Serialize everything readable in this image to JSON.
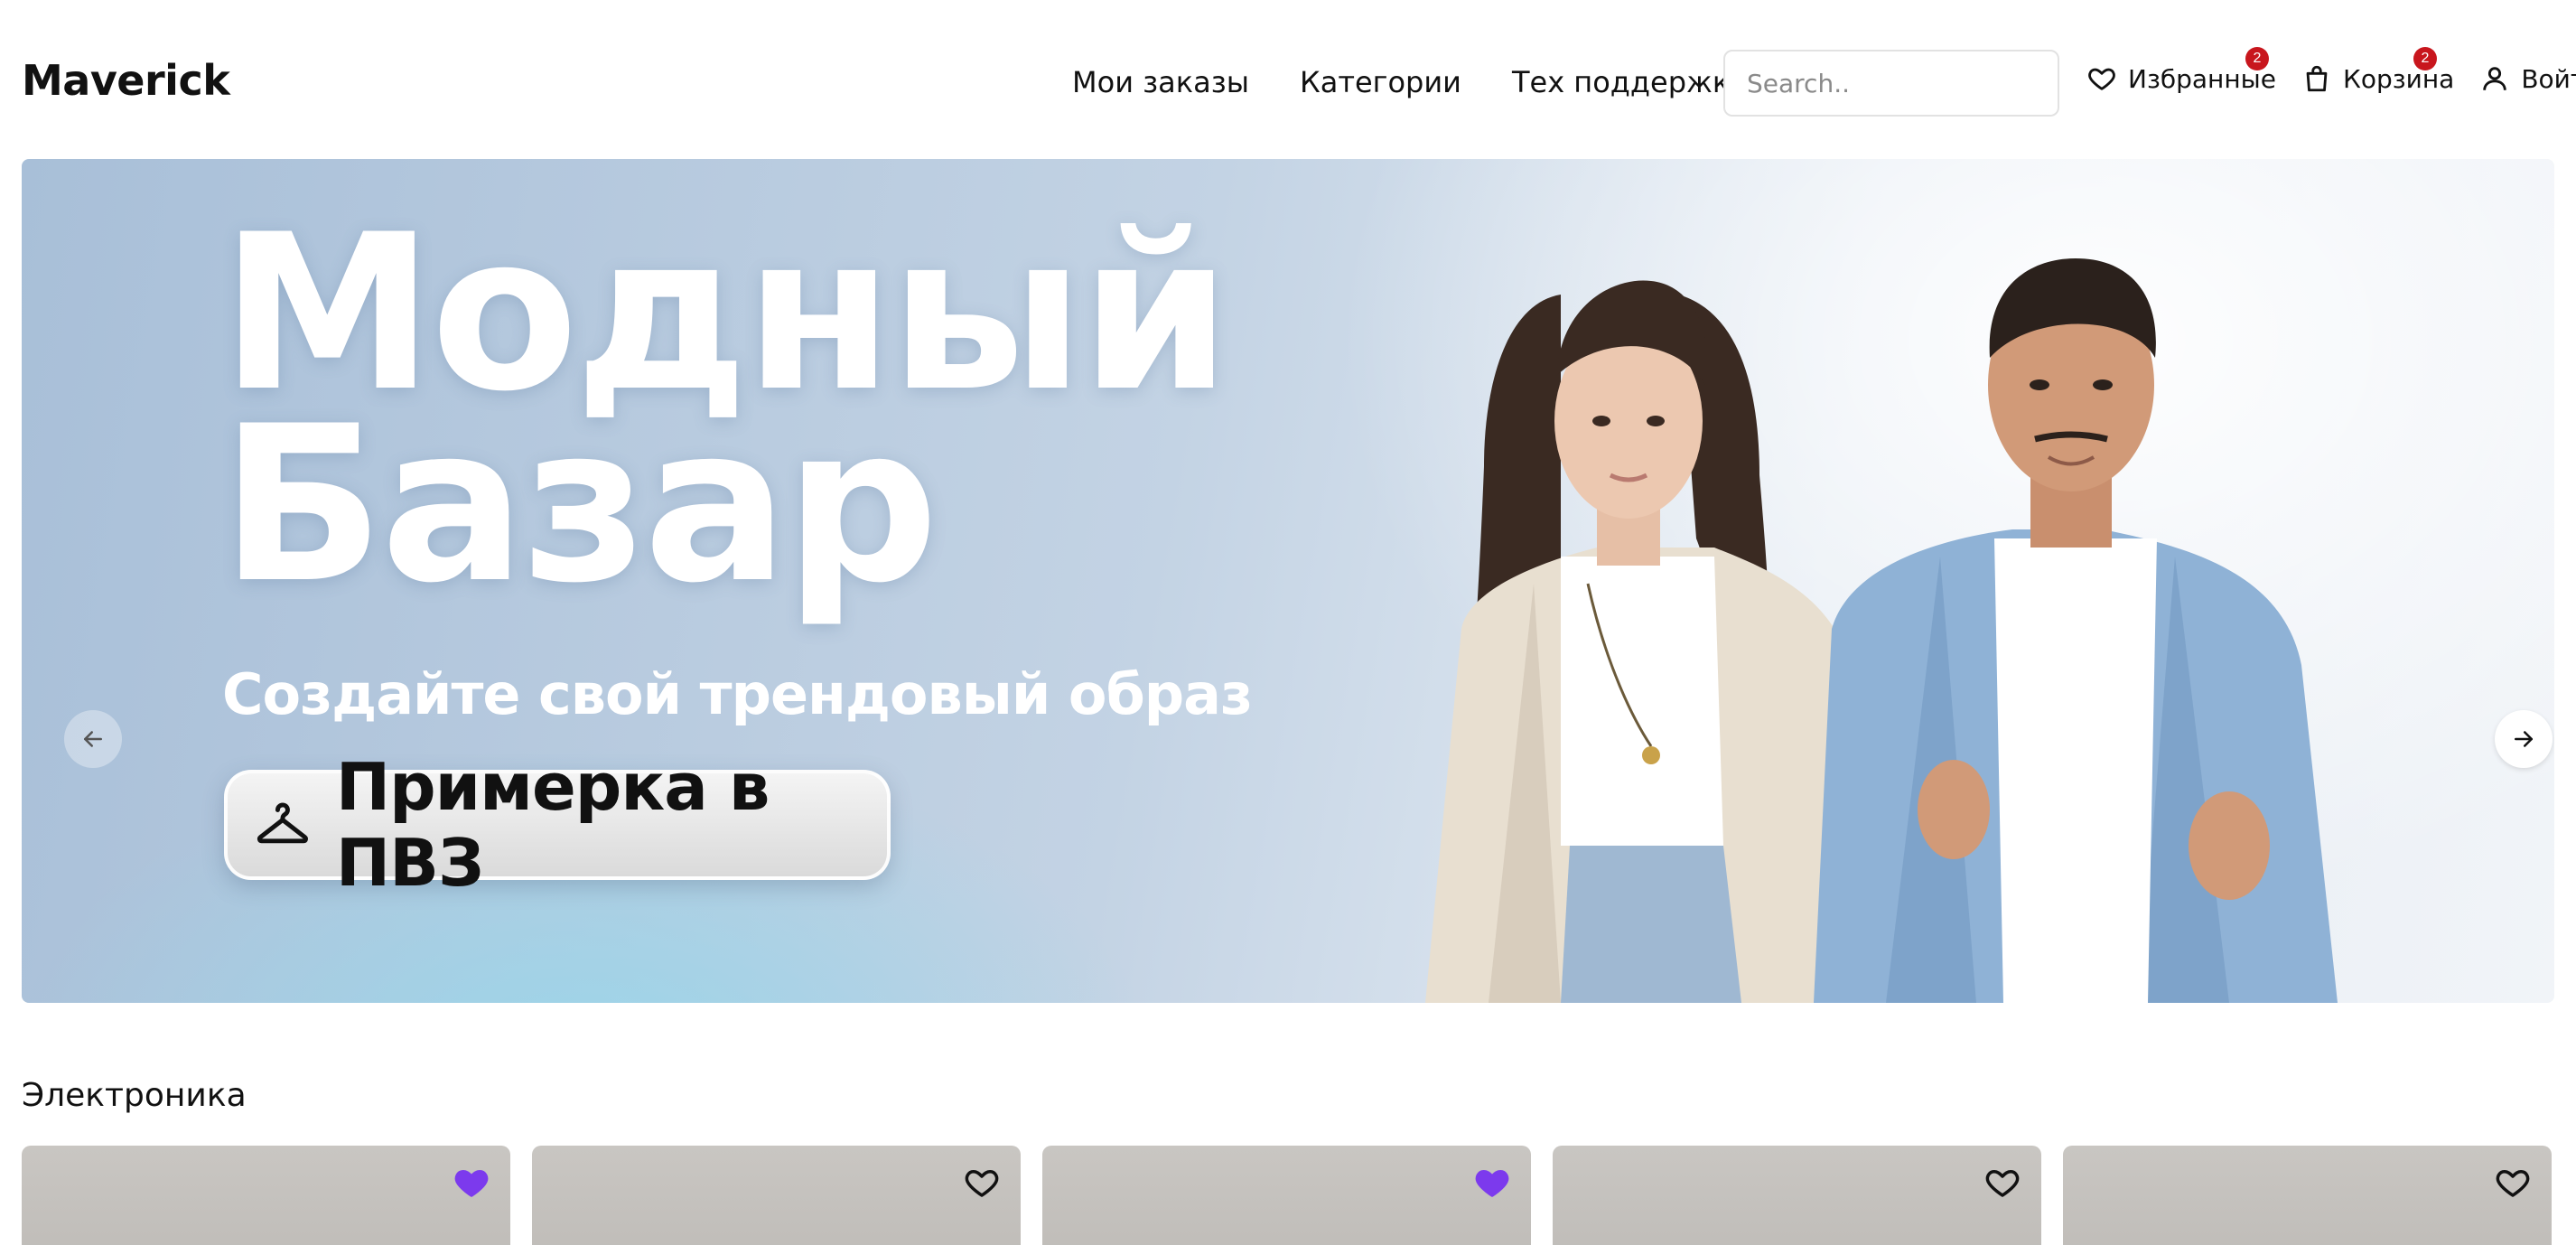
{
  "header": {
    "logo": "Maverick",
    "nav": [
      "Мои заказы",
      "Категории",
      "Тех поддержка"
    ],
    "search_placeholder": "Search..",
    "favorites_label": "Избранные",
    "favorites_count": "2",
    "cart_label": "Корзина",
    "cart_count": "2",
    "login_label": "Войти"
  },
  "banner": {
    "title_line1": "Модный",
    "title_line2": "Базар",
    "subtitle": "Создайте свой трендовый образ",
    "cta_label": "Примерка в ПВЗ"
  },
  "section": {
    "title": "Электроника",
    "cards": [
      {
        "favorited": true
      },
      {
        "favorited": false
      },
      {
        "favorited": true
      },
      {
        "favorited": false
      },
      {
        "favorited": false
      }
    ]
  },
  "colors": {
    "accent": "#7c3aed",
    "badge": "#c8161d"
  }
}
